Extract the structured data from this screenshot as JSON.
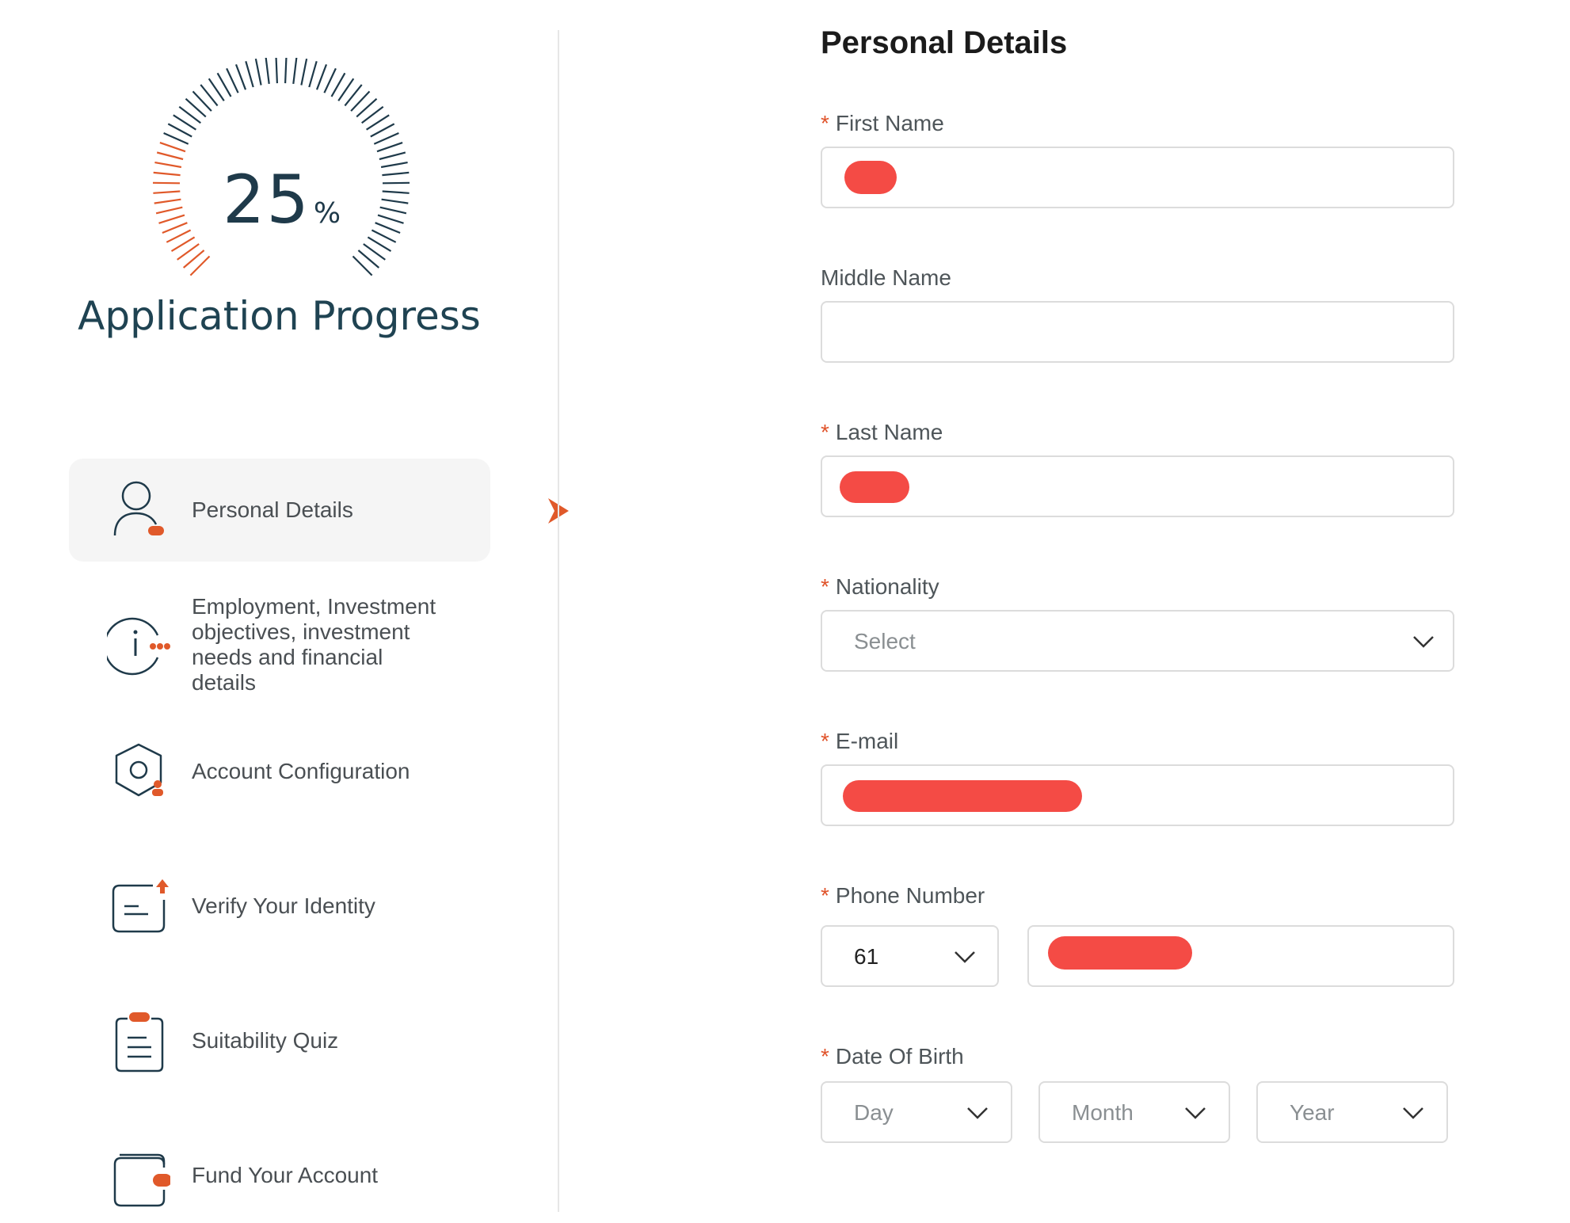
{
  "progress": {
    "value": "25",
    "percent_sign": "%",
    "percent": 25,
    "title": "Application Progress",
    "accent_color": "#e0592a",
    "track_color": "#1f3a4a"
  },
  "steps": [
    {
      "label": "Personal Details",
      "icon": "person-icon",
      "active": true
    },
    {
      "label": "Employment, Investment objectives, investment needs and financial details",
      "icon": "info-icon",
      "active": false
    },
    {
      "label": "Account Configuration",
      "icon": "hexagon-settings-icon",
      "active": false
    },
    {
      "label": "Verify Your Identity",
      "icon": "id-card-upload-icon",
      "active": false
    },
    {
      "label": "Suitability Quiz",
      "icon": "clipboard-icon",
      "active": false
    },
    {
      "label": "Fund Your Account",
      "icon": "wallet-icon",
      "active": false
    }
  ],
  "form": {
    "title": "Personal Details",
    "required_mark": "*",
    "first_name": {
      "label": "First Name",
      "required": true
    },
    "middle_name": {
      "label": "Middle Name",
      "required": false
    },
    "last_name": {
      "label": "Last Name",
      "required": true
    },
    "nationality": {
      "label": "Nationality",
      "required": true,
      "placeholder": "Select"
    },
    "email": {
      "label": "E-mail",
      "required": true
    },
    "phone": {
      "label": "Phone Number",
      "required": true,
      "country_code": "61"
    },
    "dob": {
      "label": "Date Of Birth",
      "required": true,
      "day": "Day",
      "month": "Month",
      "year": "Year"
    }
  }
}
